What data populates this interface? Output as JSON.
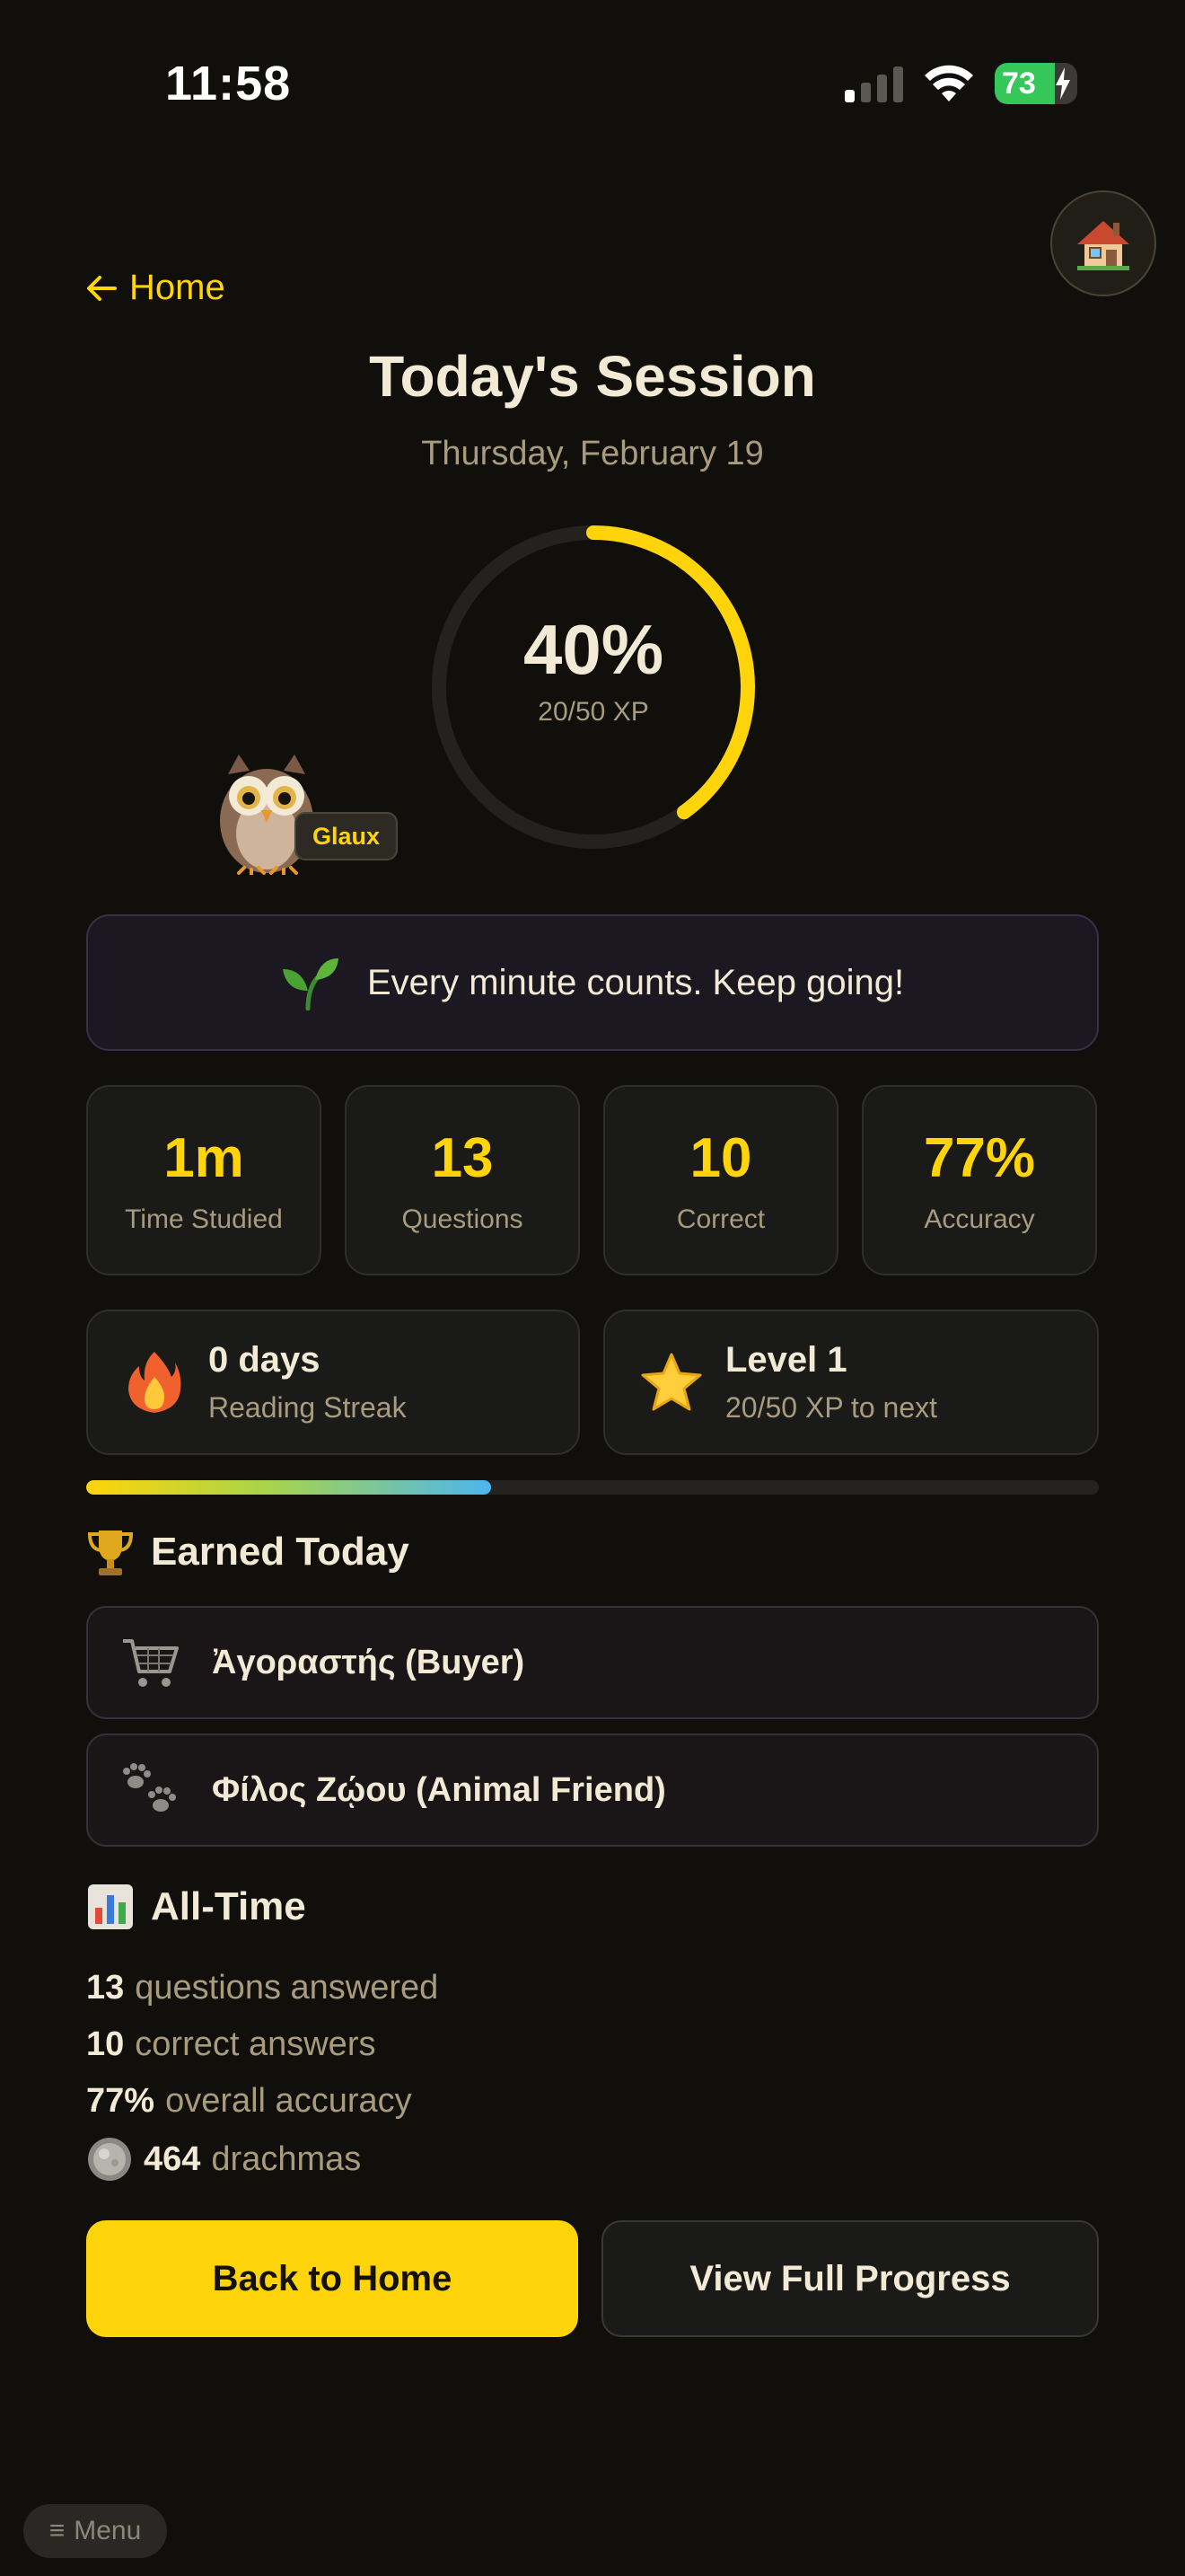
{
  "status_bar": {
    "time": "11:58",
    "battery": "73"
  },
  "nav": {
    "back_label": "Home",
    "home_icon": "house-icon"
  },
  "header": {
    "title": "Today's Session",
    "date": "Thursday, February 19"
  },
  "progress": {
    "percent_label": "40%",
    "xp_label": "20/50 XP",
    "fraction": 0.4,
    "color": "#ffd40a"
  },
  "mascot": {
    "name": "Glaux"
  },
  "motivation": {
    "icon": "seedling-icon",
    "text": "Every minute counts. Keep going!"
  },
  "stats": [
    {
      "value": "1m",
      "label": "Time Studied"
    },
    {
      "value": "13",
      "label": "Questions"
    },
    {
      "value": "10",
      "label": "Correct"
    },
    {
      "value": "77%",
      "label": "Accuracy"
    }
  ],
  "streak": {
    "icon": "fire-icon",
    "value": "0 days",
    "label": "Reading Streak"
  },
  "level": {
    "icon": "star-icon",
    "value": "Level 1",
    "label": "20/50 XP to next",
    "fraction": 0.4
  },
  "earned": {
    "heading": "Earned Today",
    "icon": "trophy-icon",
    "badges": [
      {
        "icon": "shopping-cart-icon",
        "label": "Ἀγοραστής (Buyer)"
      },
      {
        "icon": "paw-prints-icon",
        "label": "Φίλος Ζῴου (Animal Friend)"
      }
    ]
  },
  "alltime": {
    "heading": "All-Time",
    "icon": "bar-chart-icon",
    "rows": [
      {
        "value": "13",
        "text": "questions answered"
      },
      {
        "value": "10",
        "text": "correct answers"
      },
      {
        "value": "77%",
        "text": "overall accuracy"
      },
      {
        "value": "464",
        "text": "drachmas",
        "icon": "coin-icon"
      }
    ]
  },
  "buttons": {
    "primary": "Back to Home",
    "secondary": "View Full Progress"
  },
  "menu": {
    "label": "Menu"
  }
}
